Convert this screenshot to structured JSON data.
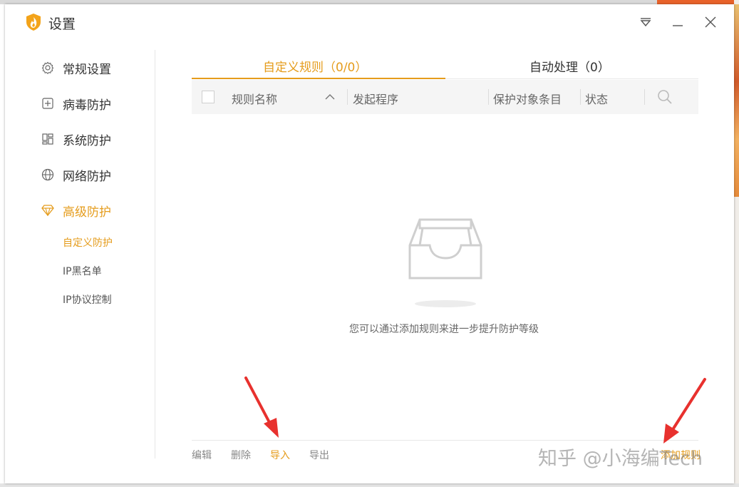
{
  "window": {
    "title": "设置"
  },
  "sidebar": {
    "items": [
      {
        "label": "常规设置",
        "icon": "gear-icon"
      },
      {
        "label": "病毒防护",
        "icon": "plus-square-icon"
      },
      {
        "label": "系统防护",
        "icon": "grid-icon"
      },
      {
        "label": "网络防护",
        "icon": "globe-icon"
      },
      {
        "label": "高级防护",
        "icon": "diamond-icon",
        "active": true
      }
    ],
    "subitems": [
      {
        "label": "自定义防护",
        "active": true
      },
      {
        "label": "IP黑名单"
      },
      {
        "label": "IP协议控制"
      }
    ]
  },
  "tabs": [
    {
      "label": "自定义规则（0/0）",
      "active": true
    },
    {
      "label": "自动处理（0）"
    }
  ],
  "table": {
    "columns": [
      "规则名称",
      "发起程序",
      "保护对象条目",
      "状态"
    ]
  },
  "empty_state": {
    "message": "您可以通过添加规则来进一步提升防护等级"
  },
  "footer": {
    "edit": "编辑",
    "delete": "删除",
    "import": "导入",
    "export": "导出",
    "add_rule": "添加规则"
  },
  "watermark": "知乎 @小海编Tech",
  "colors": {
    "accent": "#e59c1c",
    "arrow": "#e8312e"
  }
}
